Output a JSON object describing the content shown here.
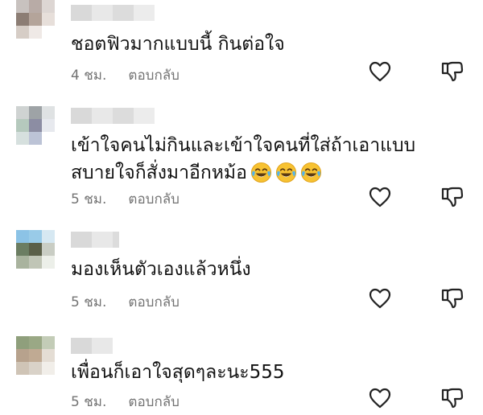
{
  "comments": [
    {
      "text": "ชอตฟิวมากแบบนี้ กินต่อใจ",
      "time": "4 ชม.",
      "reply_label": "ตอบกลับ",
      "avatar_colors": [
        "#c8c2bf",
        "#b8aba6",
        "#ddd6d3",
        "#8c7d74",
        "#b4a49a",
        "#e7dfda",
        "#d6cdc6",
        "#efe9e6",
        "#ffffff"
      ]
    },
    {
      "text": "เข้าใจคนไม่กินและเข้าใจคนที่ใส่ถ้าเอาแบบสบายใจก็สั่งมาอีกหม้อ",
      "time": "5 ชม.",
      "reply_label": "ตอบกลับ",
      "emojis": [
        "face-with-tears-of-joy",
        "face-with-tears-of-joy",
        "face-with-tears-of-joy"
      ],
      "avatar_colors": [
        "#cfd3d2",
        "#9ea3a6",
        "#dfe2e3",
        "#b5c9bd",
        "#8c8da3",
        "#e7e9ee",
        "#d6e0de",
        "#bcc3d6",
        "#ffffff"
      ]
    },
    {
      "text": "มองเห็นตัวเองแล้วหนึ่ง",
      "time": "5 ชม.",
      "reply_label": "ตอบกลับ",
      "avatar_colors": [
        "#8cc3e6",
        "#99cbe8",
        "#d6e8f2",
        "#6b7d62",
        "#5a5f48",
        "#c9cdc4",
        "#a9b39e",
        "#c0c5b6",
        "#ecefe9"
      ]
    },
    {
      "text": "เพื่อนก็เอาใจสุดๆละนะ555",
      "time": "5 ชม.",
      "reply_label": "ตอบกลับ",
      "avatar_colors": [
        "#8f9f7c",
        "#9aa885",
        "#c3ccb7",
        "#b7a28d",
        "#c0aa93",
        "#e4ddd4",
        "#cfc4b6",
        "#d9d2c8",
        "#f1eee9"
      ]
    }
  ],
  "icons": {
    "like": "heart-outline-icon",
    "dislike": "thumbs-down-outline-icon"
  },
  "colors": {
    "meta_text": "#737373",
    "body_text": "#111111"
  }
}
